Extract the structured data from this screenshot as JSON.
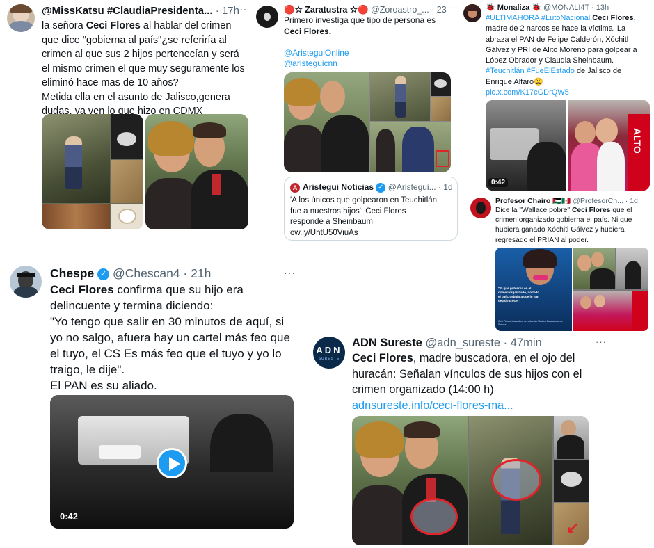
{
  "t1": {
    "name": "@MissKatsu #ClaudiaPresidenta...",
    "time": "· 17h",
    "more": "···",
    "lines": [
      [
        "la señora ",
        "Ceci Flores",
        " al hablar del crimen"
      ],
      [
        "que dice \"gobierna al país\"¿se referiría al"
      ],
      [
        "crimen al que sus 2 hijos pertenecían y será"
      ],
      [
        "el mismo crimen el que muy seguramente los"
      ],
      [
        "eliminó hace mas de 10 años?"
      ],
      [
        "Metida ella en el asunto de Jalisco,genera"
      ],
      [
        "dudas, ya ven lo que hizo en CDMX"
      ]
    ]
  },
  "t2": {
    "name": "🔴☆ Zaratustra ☆🔴",
    "handle": "@Zoroastro_...",
    "time": "· 23h",
    "more": "···",
    "line1": "Primero investiga que tipo de persona es",
    "line2": "Ceci Flores.",
    "link1": "@AristeguiOnline",
    "link2": "@aristeguicnn",
    "quote": {
      "name": "Aristegui Noticias",
      "handle": "@Aristegui...",
      "time": "· 1d",
      "lines": [
        "'A los únicos que golpearon en Teuchitlán",
        "fue a nuestros hijos': Ceci Flores",
        "responde a Sheinbaum",
        "ow.ly/UhtU50ViuAs"
      ]
    }
  },
  "t3": {
    "name": "🐞 Monaliza 🐞",
    "handle": "@MONALI4T",
    "time": "· 13h",
    "lines": [
      [
        "#ULTIMAHORA #LutoNacional ",
        "Ceci Flores",
        ","
      ],
      [
        "madre de 2 narcos se hace la víctima. La"
      ],
      [
        "abraza el PAN de Felipe Calderón, Xóchitl"
      ],
      [
        "Gálvez y PRI de Alito Moreno para golpear a"
      ],
      [
        "López Obrador y Claudia Sheinbaum."
      ],
      [
        "#Teuchitlán #FueElEstado",
        " de Jalisco de"
      ],
      [
        "Enrique Alfaro😩"
      ]
    ],
    "link": "pic.x.com/K17cGDrQW5",
    "duration": "0:42"
  },
  "t4": {
    "name": "Profesor Chairo 🇵🇸🇲🇽",
    "handle": "@ProfesorCh...",
    "time": "· 1d",
    "lines": [
      [
        "Dice la \"Wallace pobre\" ",
        "Ceci Flores",
        " que el"
      ],
      [
        "crimen organizado gobierna el país. Ni que"
      ],
      [
        "hubiera ganado Xóchitl Gálvez y hubiera"
      ],
      [
        "regresado el PRIAN al poder."
      ]
    ],
    "quote_overlay": "\"El que gobierna en el crimen organizado, no todo el país, debido a que lo han dejado crecer\"",
    "caption": "Ceci Flores, buscadora del colectivo Madres Buscadoras de Sonora"
  },
  "t5": {
    "name": "Chespe",
    "handle": "@Chescan4",
    "time": "· 21h",
    "more": "···",
    "l1a": "Ceci Flores",
    "l1b": " confirma que su hijo era",
    "l2": "delincuente y termina diciendo:",
    "l3": "\"Yo tengo que salir en 30 minutos de aquí, si",
    "l4": "yo no salgo, afuera hay un cartel más feo que",
    "l5": "el tuyo, el CS Es más feo que el tuyo y yo lo",
    "l6": "traigo, le dije\".",
    "l7": "El PAN es su aliado.",
    "duration": "0:42"
  },
  "t6": {
    "name": "ADN Sureste",
    "handle": "@adn_sureste",
    "time": "· 47min",
    "more": "···",
    "avatar_text": "ADN",
    "avatar_sub": "SURESTE",
    "l1a": "Ceci Flores",
    "l1b": ", madre buscadora, en el ojo del",
    "l2": "huracán: Señalan vínculos de sus hijos con el",
    "l3": "crimen organizado (14:00 h)",
    "link": "adnsureste.info/ceci-flores-ma..."
  },
  "colors": {
    "link": "#1d9bf0",
    "muted": "#536471",
    "text": "#0f1419",
    "alto_red": "#d0021b",
    "circle_red": "#e0242a"
  }
}
